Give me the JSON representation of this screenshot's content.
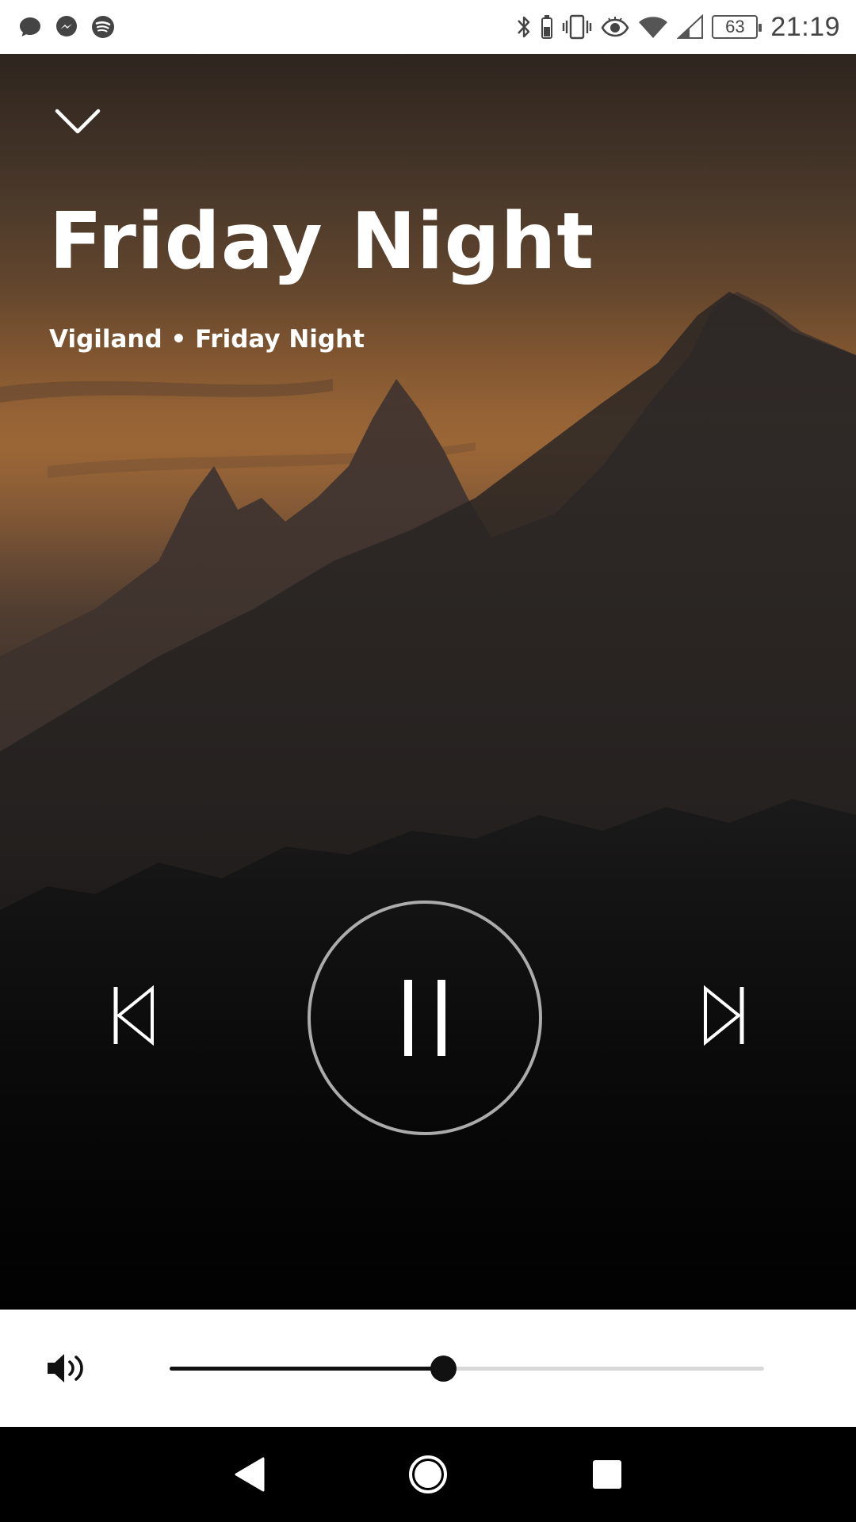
{
  "status_bar": {
    "time": "21:19",
    "battery_percent": "63",
    "notification_icons": [
      "chat-bubble-icon",
      "messenger-icon",
      "spotify-icon"
    ],
    "system_icons": [
      "bluetooth-icon",
      "vibrate-icon",
      "eye-icon",
      "wifi-icon",
      "cell-signal-icon",
      "battery-icon"
    ]
  },
  "player": {
    "title": "Friday Night",
    "subtitle": "Vigiland • Friday Night",
    "is_playing": true,
    "collapse_icon": "chevron-down-icon",
    "prev_icon": "skip-previous-icon",
    "play_pause_icon": "pause-icon",
    "next_icon": "skip-next-icon"
  },
  "volume": {
    "icon": "speaker-icon",
    "level": 0.46
  },
  "nav_bar": {
    "back_icon": "back-triangle-icon",
    "home_icon": "home-circle-icon",
    "recents_icon": "recents-square-icon"
  },
  "colors": {
    "sky_orange": "#8f6136",
    "mountain_dark": "#2a2624",
    "slider_active": "#111111",
    "slider_inactive": "#d8d8d8",
    "play_ring": "#c8c8c8"
  }
}
